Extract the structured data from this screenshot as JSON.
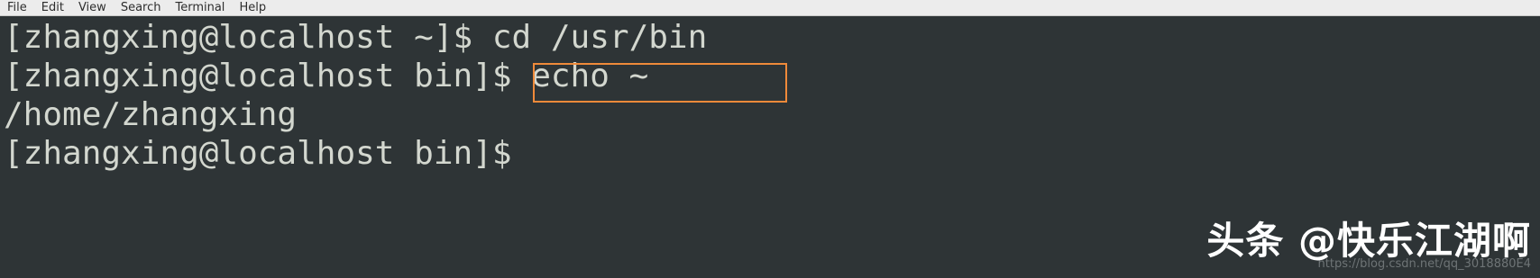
{
  "menubar": {
    "items": [
      "File",
      "Edit",
      "View",
      "Search",
      "Terminal",
      "Help"
    ]
  },
  "terminal": {
    "lines": [
      "[zhangxing@localhost ~]$ cd /usr/bin",
      "[zhangxing@localhost bin]$ echo ~",
      "/home/zhangxing",
      "[zhangxing@localhost bin]$"
    ],
    "highlight_color": "#ef8a3a",
    "background_color": "#2e3436",
    "text_color": "#d3d7cf"
  },
  "watermark": {
    "brand": "头条 @快乐江湖啊",
    "url": "https://blog.csdn.net/qq_3018880E4"
  }
}
